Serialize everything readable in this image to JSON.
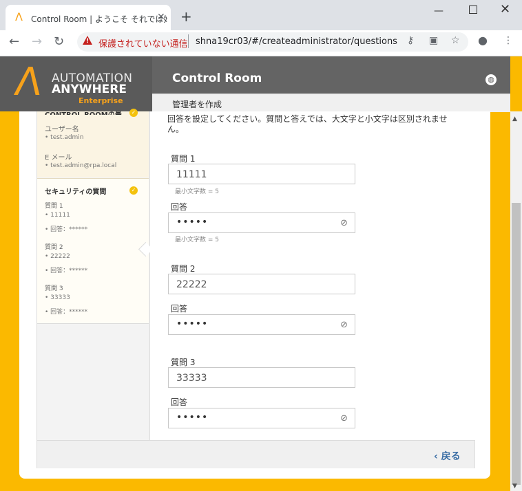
{
  "browser": {
    "tab_title": "Control Room | ようこそ それでは始め",
    "tab_close": "✕",
    "new_tab": "+",
    "not_secure": "保護されていない通信",
    "url": "shna19cr03/#/createadministrator/questions"
  },
  "header": {
    "logo_line1": "AUTOMATION",
    "logo_line2": "ANYWHERE",
    "logo_line3": "Enterprise",
    "title": "Control Room",
    "subtitle": "管理者を作成"
  },
  "sidebar": {
    "truncated_heading": "CONTROL ROOMの最...",
    "user_label": "ユーザー名",
    "user_value": "• test.admin",
    "email_label": "E メール",
    "email_value": "• test.admin@rpa.local",
    "security_heading": "セキュリティの質問",
    "q1_label": "質問 1",
    "q1_value": "• 11111",
    "q1_answer": "• 回答：******",
    "q2_label": "質問 2",
    "q2_value": "• 22222",
    "q2_answer": "• 回答：******",
    "q3_label": "質問 3",
    "q3_value": "• 33333",
    "q3_answer": "• 回答：******"
  },
  "form": {
    "instruction": "回答を設定してください。質問と答えでは、大文字と小文字は区別されません。",
    "q1_label": "質問 1",
    "q1_value": "11111",
    "q1_hint": "最小文字数 = 5",
    "a1_label": "回答",
    "a1_dots": "•••••",
    "a1_hint": "最小文字数 = 5",
    "q2_label": "質問 2",
    "q2_value": "22222",
    "a2_label": "回答",
    "a2_dots": "•••••",
    "q3_label": "質問 3",
    "q3_value": "33333",
    "a3_label": "回答",
    "a3_dots": "•••••"
  },
  "footer": {
    "back_label": "‹ 戻る"
  },
  "colors": {
    "brand_orange": "#f7a21b",
    "page_yellow": "#fbb900",
    "header_gray": "#646464",
    "link_blue": "#3a6ea5",
    "check_yellow": "#f4c20d"
  }
}
